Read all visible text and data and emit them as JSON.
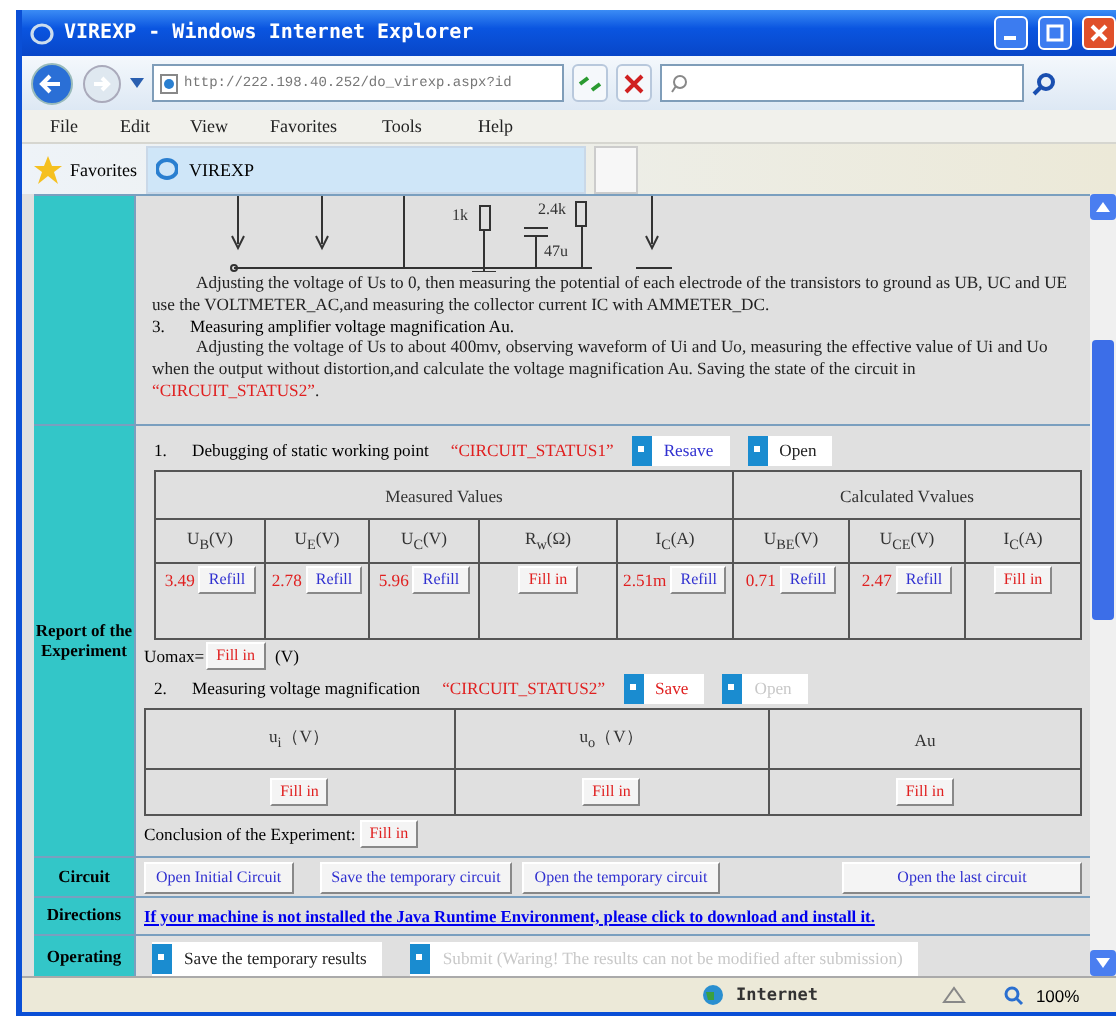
{
  "window": {
    "title": "VIREXP - Windows Internet Explorer"
  },
  "address_bar": {
    "url": "http://222.198.40.252/do_virexp.aspx?id"
  },
  "menu": [
    "File",
    "Edit",
    "View",
    "Favorites",
    "Tools",
    "Help"
  ],
  "favorites_bar": {
    "label": "Favorites",
    "tab": "VIREXP"
  },
  "circuit_labels": [
    "1k",
    "2.4k",
    "47u"
  ],
  "instructions": [
    {
      "kind": "paragraph",
      "text": "Adjusting the voltage of Us to 0, then measuring the potential of each electrode of the transistors to ground as UB, UC and UE use the VOLTMETER_AC,and measuring the collector current IC with AMMETER_DC."
    },
    {
      "kind": "item",
      "number": "3.",
      "text": "Measuring amplifier voltage magnification Au."
    },
    {
      "kind": "paragraph",
      "text": "Adjusting the voltage of Us to about 400mv, observing waveform of Ui and Uo, measuring the effective value of Ui and Uo when the output without distortion,and calculate the voltage magnification Au. Saving the state of the circuit in ",
      "status": "“CIRCUIT_STATUS2”",
      "tail": "."
    }
  ],
  "report": {
    "label": "Report of the Experiment",
    "step1": {
      "number": "1.",
      "text": "Debugging of static working point",
      "status": "“CIRCUIT_STATUS1”",
      "buttons": [
        {
          "label": "Resave",
          "kind": "resave",
          "disabled": false
        },
        {
          "label": "Open",
          "kind": "open",
          "disabled": false
        }
      ]
    },
    "table1": {
      "groups": [
        {
          "label": "Measured Values"
        },
        {
          "label": "Calculated Vvalues"
        }
      ],
      "columns": [
        "U$_{B}$(V)",
        "U$_{E}$(V)",
        "U$_{C}$(V)",
        "R$_{w}$(Ω)",
        "I$_{C}$(A)",
        "U$_{BE}$(V)",
        "U$_{CE}$(V)",
        "I$_{C}$(A)"
      ],
      "cells": [
        {
          "value": "3.49",
          "button": "Refill",
          "kind": "refill"
        },
        {
          "value": "2.78",
          "button": "Refill",
          "kind": "refill"
        },
        {
          "value": "5.96",
          "button": "Refill",
          "kind": "refill"
        },
        {
          "button": "Fill in",
          "kind": "fill"
        },
        {
          "value": "2.51m",
          "button": "Refill",
          "kind": "refill"
        },
        {
          "value": "0.71",
          "button": "Refill",
          "kind": "refill"
        },
        {
          "value": "2.47",
          "button": "Refill",
          "kind": "refill"
        },
        {
          "button": "Fill in",
          "kind": "fill"
        }
      ]
    },
    "uomax": {
      "label": "Uomax=",
      "button": "Fill in",
      "unit": "(V)"
    },
    "step2": {
      "number": "2.",
      "text": "Measuring voltage magnification",
      "status": "“CIRCUIT_STATUS2”",
      "buttons": [
        {
          "label": "Save",
          "kind": "save",
          "disabled": false
        },
        {
          "label": "Open",
          "kind": "open",
          "disabled": true
        }
      ]
    },
    "table2": {
      "columns": [
        "u$_{i}$（V）",
        "u$_{o}$（V）",
        "Au"
      ],
      "cells": [
        {
          "button": "Fill in"
        },
        {
          "button": "Fill in"
        },
        {
          "button": "Fill in"
        }
      ]
    },
    "conclusion": {
      "label": "Conclusion of the Experiment:",
      "button": "Fill in"
    }
  },
  "circuit": {
    "label": "Circuit",
    "buttons": [
      "Open Initial Circuit",
      "Save the temporary circuit",
      "Open the temporary circuit",
      "Open the last circuit"
    ]
  },
  "directions": {
    "label": "Directions",
    "link": "If your machine is not installed the Java Runtime Environment, please click to download and install it."
  },
  "operating": {
    "label": "Operating",
    "buttons": [
      {
        "label": "Save the temporary results",
        "disabled": false
      },
      {
        "label": "Submit (Waring! The results can not be modified after submission)",
        "disabled": true
      }
    ]
  },
  "status_bar": {
    "zone": "Internet",
    "zoom": "100%"
  }
}
